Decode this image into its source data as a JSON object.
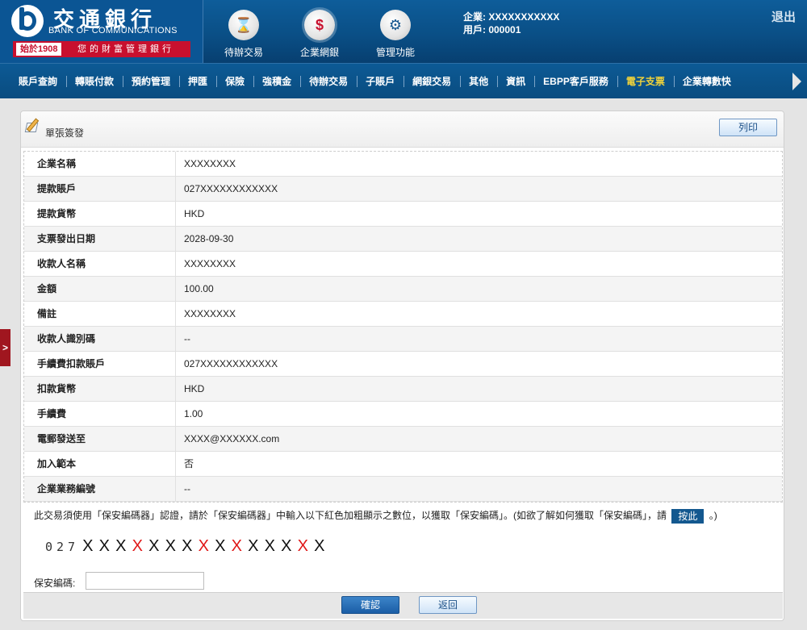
{
  "header": {
    "logo_cn": "交通銀行",
    "logo_en": "BANK OF COMMUNICATIONS",
    "logo_since": "始於1908",
    "logo_slogan": "您的財富管理銀行",
    "nav": [
      {
        "label": "待辦交易",
        "icon": "hourglass-icon",
        "glyph": "⌛"
      },
      {
        "label": "企業網銀",
        "icon": "monitor-dollar-icon",
        "glyph": "$"
      },
      {
        "label": "管理功能",
        "icon": "gears-icon",
        "glyph": "⚙"
      }
    ],
    "company_line": "企業: XXXXXXXXXXX",
    "user_line": "用戶: 000001",
    "logout": "退出"
  },
  "menu": {
    "items": [
      "賬戶查詢",
      "轉賬付款",
      "預約管理",
      "押匯",
      "保險",
      "強積金",
      "待辦交易",
      "子賬戶",
      "網銀交易",
      "其他",
      "資訊",
      "EBPP客戶服務",
      "電子支票",
      "企業轉數快"
    ],
    "active_index": 12
  },
  "side_tab": ">",
  "panel": {
    "title": "單張簽發",
    "print_label": "列印",
    "rows": [
      {
        "k": "企業名稱",
        "v": "XXXXXXXX"
      },
      {
        "k": "提款賬戶",
        "v": "027XXXXXXXXXXXX"
      },
      {
        "k": "提款貨幣",
        "v": "HKD"
      },
      {
        "k": "支票發出日期",
        "v": "2028-09-30"
      },
      {
        "k": "收款人名稱",
        "v": "XXXXXXXX"
      },
      {
        "k": "金額",
        "v": "100.00"
      },
      {
        "k": "備註",
        "v": "XXXXXXXX"
      },
      {
        "k": "收款人識別碼",
        "v": "--"
      },
      {
        "k": "手續費扣款賬戶",
        "v": "027XXXXXXXXXXXX"
      },
      {
        "k": "扣款貨幣",
        "v": "HKD"
      },
      {
        "k": "手續費",
        "v": "1.00"
      },
      {
        "k": "電郵發送至",
        "v": "XXXX@XXXXXX.com"
      },
      {
        "k": "加入範本",
        "v": "否"
      },
      {
        "k": "企業業務編號",
        "v": "--"
      }
    ],
    "notice_before": "此交易須使用「保安編碼器」認證，請於「保安編碼器」中輸入以下紅色加粗顯示之數位，以獲取「保安編碼」。(如欲了解如何獲取「保安編碼」，請",
    "notice_button": "按此",
    "notice_after": "。)",
    "token_prefix": "027",
    "token_chars": [
      {
        "c": "X",
        "red": false
      },
      {
        "c": "X",
        "red": false
      },
      {
        "c": "X",
        "red": false
      },
      {
        "c": "X",
        "red": true
      },
      {
        "c": "X",
        "red": false
      },
      {
        "c": "X",
        "red": false
      },
      {
        "c": "X",
        "red": false
      },
      {
        "c": "X",
        "red": true
      },
      {
        "c": "X",
        "red": false
      },
      {
        "c": "X",
        "red": true
      },
      {
        "c": "X",
        "red": false
      },
      {
        "c": "X",
        "red": false
      },
      {
        "c": "X",
        "red": false
      },
      {
        "c": "X",
        "red": true
      },
      {
        "c": "X",
        "red": false
      }
    ],
    "code_label": "保安編碼:",
    "code_value": "",
    "confirm_label": "確認",
    "back_label": "返回"
  },
  "colors": {
    "header_blue": "#0a4f86",
    "active_menu": "#f1d33a",
    "token_red": "#e01818",
    "brand_red": "#c8102e"
  }
}
